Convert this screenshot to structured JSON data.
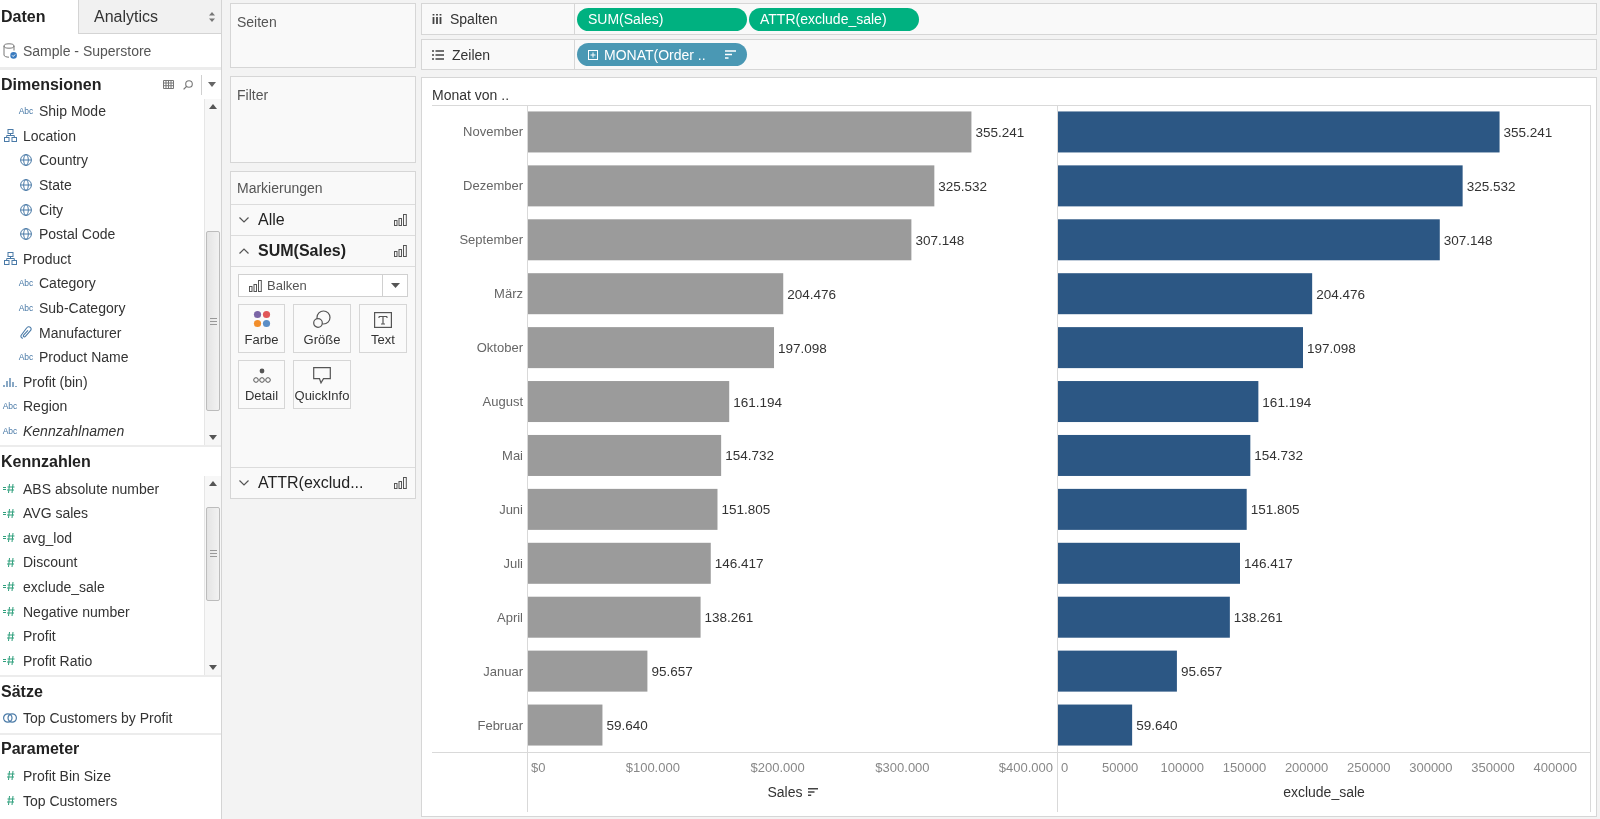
{
  "data_pane": {
    "tabs": [
      {
        "label": "Daten",
        "selected": true
      },
      {
        "label": "Analytics",
        "selected": false
      }
    ],
    "source": "Sample - Superstore",
    "sections": [
      {
        "title": "Dimensionen",
        "toolbar": true,
        "scrollbar": true,
        "items": [
          {
            "children": [
              {
                "kind": "string",
                "badge": "Abc",
                "label": "Ship Mode"
              }
            ]
          },
          {
            "kind": "hierarchy",
            "label": "Location",
            "children": [
              {
                "kind": "geo",
                "label": "Country"
              },
              {
                "kind": "geo",
                "label": "State"
              },
              {
                "kind": "geo",
                "label": "City"
              },
              {
                "kind": "geo",
                "label": "Postal Code"
              }
            ]
          },
          {
            "kind": "hierarchy",
            "label": "Product",
            "children": [
              {
                "kind": "string",
                "badge": "Abc",
                "label": "Category"
              },
              {
                "kind": "string",
                "badge": "Abc",
                "label": "Sub-Category"
              },
              {
                "kind": "group",
                "label": "Manufacturer"
              },
              {
                "kind": "string",
                "badge": "Abc",
                "label": "Product Name"
              }
            ]
          },
          {
            "kind": "bin",
            "label": "Profit (bin)"
          },
          {
            "kind": "string",
            "badge": "Abc",
            "label": "Region"
          },
          {
            "kind": "generated",
            "badge": "Abc",
            "label": "Kennzahlnamen"
          }
        ]
      },
      {
        "title": "Kennzahlen",
        "toolbar": false,
        "scrollbar": true,
        "items": [
          {
            "kind": "calculated",
            "label": "ABS absolute number"
          },
          {
            "kind": "calculated",
            "label": "AVG sales"
          },
          {
            "kind": "calculated",
            "label": "avg_lod"
          },
          {
            "kind": "number",
            "label": "Discount"
          },
          {
            "kind": "calculated",
            "label": "exclude_sale"
          },
          {
            "kind": "calculated",
            "label": "Negative number"
          },
          {
            "kind": "number",
            "label": "Profit"
          },
          {
            "kind": "calculated",
            "label": "Profit Ratio"
          }
        ]
      },
      {
        "title": "Sätze",
        "toolbar": false,
        "scrollbar": false,
        "items": [
          {
            "kind": "set",
            "label": "Top Customers by Profit"
          }
        ]
      },
      {
        "title": "Parameter",
        "toolbar": false,
        "scrollbar": false,
        "items": [
          {
            "kind": "number",
            "label": "Profit Bin Size"
          },
          {
            "kind": "number",
            "label": "Top Customers"
          }
        ]
      }
    ]
  },
  "shelves_panel": {
    "pages": "Seiten",
    "filters": "Filter",
    "marks": {
      "title": "Markierungen",
      "cards": [
        {
          "label": "Alle",
          "expanded": false
        },
        {
          "label": "SUM(Sales)",
          "expanded": true,
          "mark_type": "Balken",
          "properties": [
            {
              "kind": "color",
              "label": "Farbe"
            },
            {
              "kind": "size",
              "label": "Größe"
            },
            {
              "kind": "text",
              "label": "Text"
            },
            {
              "kind": "detail",
              "label": "Detail"
            },
            {
              "kind": "tooltip",
              "label": "QuickInfo"
            }
          ]
        },
        {
          "label": "ATTR(exclud...",
          "expanded": false
        }
      ]
    }
  },
  "shelves": [
    {
      "kind": "columns",
      "label": "Spalten",
      "pills": [
        {
          "kind": "measure",
          "label": "SUM(Sales)",
          "drill": false,
          "sorted": false
        },
        {
          "kind": "measure",
          "label": "ATTR(exclude_sale)",
          "drill": false,
          "sorted": false
        }
      ]
    },
    {
      "kind": "rows",
      "label": "Zeilen",
      "pills": [
        {
          "kind": "dimension",
          "label": "MONAT(Order ..",
          "drill": true,
          "sorted": true
        }
      ]
    }
  ],
  "view": {
    "panes": [
      {
        "axis_sorted": true,
        "chart_data": {
          "type": "bar",
          "orientation": "horizontal",
          "ylabel": "Monat von ..",
          "xlabel": "Sales",
          "categories": [
            "November",
            "Dezember",
            "September",
            "März",
            "Oktober",
            "August",
            "Mai",
            "Juni",
            "Juli",
            "April",
            "Januar",
            "Februar"
          ],
          "series": [
            {
              "color": "#9b9b9b",
              "values": [
                355241,
                325532,
                307148,
                204476,
                197098,
                161194,
                154732,
                151805,
                146417,
                138261,
                95657,
                59640
              ]
            }
          ],
          "xlim": [
            0,
            423000
          ],
          "xticks": [
            {
              "value": 0,
              "label": "$0"
            },
            {
              "value": 100000,
              "label": "$100.000"
            },
            {
              "value": 200000,
              "label": "$200.000"
            },
            {
              "value": 300000,
              "label": "$300.000"
            },
            {
              "value": 400000,
              "label": "$400.000"
            }
          ],
          "value_labels": [
            "355.241",
            "325.532",
            "307.148",
            "204.476",
            "197.098",
            "161.194",
            "154.732",
            "151.805",
            "146.417",
            "138.261",
            "95.657",
            "59.640"
          ]
        }
      },
      {
        "axis_sorted": false,
        "chart_data": {
          "type": "bar",
          "orientation": "horizontal",
          "xlabel": "exclude_sale",
          "series": [
            {
              "color": "#2c5784",
              "values": [
                355241,
                325532,
                307148,
                204476,
                197098,
                161194,
                154732,
                151805,
                146417,
                138261,
                95657,
                59640
              ]
            }
          ],
          "xlim": [
            0,
            428000
          ],
          "xticks": [
            0,
            50000,
            100000,
            150000,
            200000,
            250000,
            300000,
            350000,
            400000
          ],
          "value_labels": [
            "355.241",
            "325.532",
            "307.148",
            "204.476",
            "197.098",
            "161.194",
            "154.732",
            "151.805",
            "146.417",
            "138.261",
            "95.657",
            "59.640"
          ]
        }
      }
    ]
  }
}
